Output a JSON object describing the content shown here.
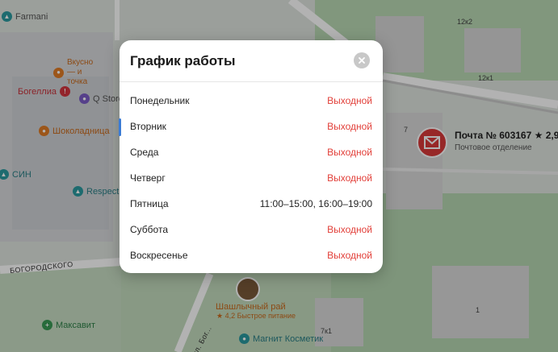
{
  "map": {
    "pois": [
      {
        "name": "Farmani",
        "color": "teal"
      },
      {
        "name": "Вкусно — и точка",
        "color": "orange"
      },
      {
        "name": "Богеллиа",
        "color": "red"
      },
      {
        "name": "Q Store",
        "color": "teal"
      },
      {
        "name": "Шоколадница",
        "color": "orange"
      },
      {
        "name": "СИН",
        "color": "teal"
      },
      {
        "name": "Respect",
        "color": "teal"
      },
      {
        "name": "Максавит",
        "color": "green"
      },
      {
        "name": "Магнит Косметик",
        "color": "teal"
      },
      {
        "name": "Шашлычный рай",
        "color": "orange"
      },
      {
        "name": "★ 4,2 Быстрое питание",
        "color": "orange"
      }
    ],
    "house_numbers": [
      "12к2",
      "12к1",
      "7",
      "7к1",
      "1"
    ],
    "streets": [
      "БОГОРОДСКОГО",
      "ул. Бог..."
    ],
    "post_office": {
      "title": "Почта № 603167",
      "rating": "★ 2,9",
      "subtitle": "Почтовое отделение"
    }
  },
  "modal": {
    "title": "График работы",
    "close_icon": "close-icon",
    "today_index": 1,
    "days": [
      {
        "day": "Понедельник",
        "hours": "Выходной",
        "closed": true
      },
      {
        "day": "Вторник",
        "hours": "Выходной",
        "closed": true
      },
      {
        "day": "Среда",
        "hours": "Выходной",
        "closed": true
      },
      {
        "day": "Четверг",
        "hours": "Выходной",
        "closed": true
      },
      {
        "day": "Пятница",
        "hours": "11:00–15:00, 16:00–19:00",
        "closed": false
      },
      {
        "day": "Суббота",
        "hours": "Выходной",
        "closed": true
      },
      {
        "day": "Воскресенье",
        "hours": "Выходной",
        "closed": true
      }
    ]
  },
  "colors": {
    "closed_text": "#e2403a",
    "today_marker": "#3a7bd5",
    "post_marker": "#d83a3a"
  }
}
